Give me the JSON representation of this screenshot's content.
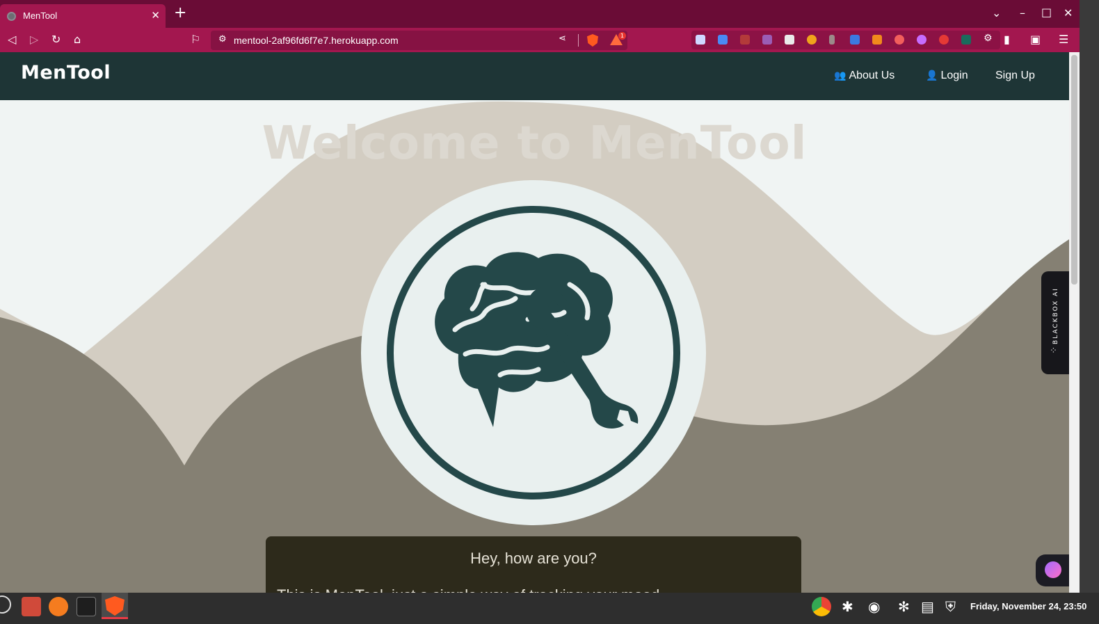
{
  "browser": {
    "tab_title": "MenTool",
    "url": "mentool-2af96fd6f7e7.herokuapp.com",
    "alert_count": "1"
  },
  "site": {
    "brand": "MenTool",
    "nav": [
      {
        "label": "About Us",
        "icon": "users-icon"
      },
      {
        "label": "Login",
        "icon": "user-icon"
      },
      {
        "label": "Sign Up",
        "icon": ""
      }
    ],
    "hero_title": "Welcome to MenTool",
    "card_heading": "Hey, how are you?",
    "card_text": "This is MenTool, just a simple way of tracking your mood"
  },
  "blackbox": {
    "label": "BLACKBOX AI"
  },
  "taskbar": {
    "clock": "Friday, November 24, 23:50"
  },
  "colors": {
    "tab_bar": "#6a0c36",
    "toolbar": "#a3174f",
    "navbar": "#1e3536",
    "wave_light": "#d3cdc2",
    "wave_dark": "#858073",
    "logo_dark": "#244849",
    "card": "#2d2a1b"
  }
}
